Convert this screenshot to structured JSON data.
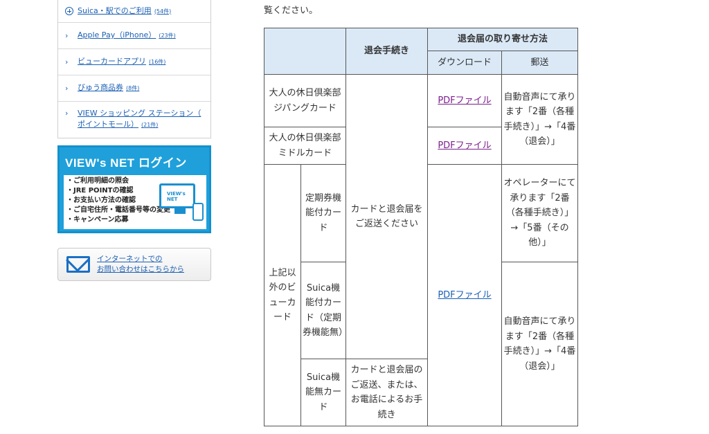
{
  "sidebar": {
    "items": [
      {
        "label": "Suica・駅でのご利用",
        "count": "(54件)"
      },
      {
        "label": "Apple Pay（iPhone）",
        "count": "(23件)"
      },
      {
        "label": "ビューカードアプリ",
        "count": "(16件)"
      },
      {
        "label": "びゅう商品券",
        "count": "(8件)"
      },
      {
        "label": "VIEW ショッピング ステーション（ ポイントモール）",
        "count": "(21件)"
      }
    ]
  },
  "banner": {
    "title": "VIEW's NET ログイン",
    "items": [
      "・ご利用明細の照会",
      "・JRE POINTの確認",
      "・お支払い方法の確認",
      "・ご自宅住所・電話番号等の変更",
      "・キャンペーン応募"
    ],
    "monitor_text": "VIEW's NET"
  },
  "contact": {
    "line1": "インターネットでの",
    "line2": "お問い合わせはこちらから"
  },
  "intro_text": "覧ください。",
  "table": {
    "header": {
      "procedure": "退会手続き",
      "method": "退会届の取り寄せ方法",
      "download": "ダウンロード",
      "mail": "郵送"
    },
    "rows": {
      "r1_card": "大人の休日倶楽部ジパングカード",
      "r2_card": "大人の休日倶楽部ミドルカード",
      "group_card": "上記以外のビューカード",
      "r3_sub": "定期券機能付カード",
      "r4_sub": "Suica機能付カード（定期券機能無）",
      "r5_sub": "Suica機能無カード",
      "proc_main": "カードと退会届をご返送ください",
      "proc_last": "カードと退会届のご返送、または、お電話によるお手続き",
      "pdf": "PDFファイル",
      "mail_auto": "自動音声にて承ります「2番（各種手続き）」→「4番（退会）」",
      "mail_operator": "オペレーターにて承ります「2番（各種手続き）」→「5番（その他）」"
    }
  }
}
